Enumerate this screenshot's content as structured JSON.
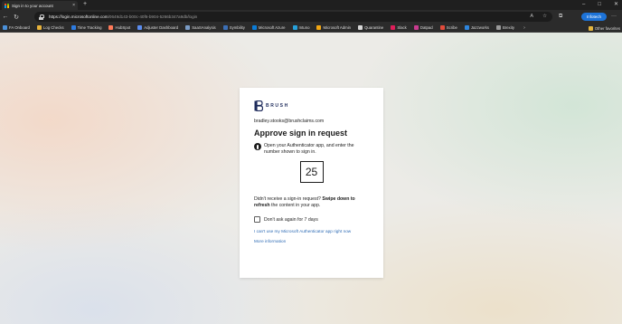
{
  "browser": {
    "tab_title": "Sign in to your account",
    "tab_close": "×",
    "new_tab": "+",
    "url_host": "https://login.microsoftonline.com",
    "url_path": "/0649d143-b00c-40f6-b904-5266b347a9db/login",
    "profile_label": "Infotech",
    "more": "···",
    "bookmarks": [
      {
        "label": "FA Onboard",
        "color": "#4a90d9"
      },
      {
        "label": "Log Checks",
        "color": "#e8b33b"
      },
      {
        "label": "Time Tracking",
        "color": "#2d7be0"
      },
      {
        "label": "HubSpot",
        "color": "#ff7a59"
      },
      {
        "label": "Adjuster Dashboard",
        "color": "#5b8def"
      },
      {
        "label": "SaaSAnalysis",
        "color": "#7a9cc6"
      },
      {
        "label": "Symbility",
        "color": "#3b6fb6"
      },
      {
        "label": "Microsoft Azure",
        "color": "#0a7bd6"
      },
      {
        "label": "Intuno",
        "color": "#26a0da"
      },
      {
        "label": "Microsoft Admin",
        "color": "#f3a712"
      },
      {
        "label": "Quarantine",
        "color": "#d8d8d8"
      },
      {
        "label": "Slack",
        "color": "#e01e5a"
      },
      {
        "label": "Datpad",
        "color": "#c93b8f"
      },
      {
        "label": "Scribe",
        "color": "#e24b3b"
      },
      {
        "label": "Jazzworks",
        "color": "#2e86de"
      },
      {
        "label": "Brexity",
        "color": "#9a9a9a"
      }
    ],
    "bookmarks_more": "›",
    "other_favorites": "Other favorites"
  },
  "card": {
    "logo_text": "BRUSH",
    "email": "bradley.stooks@brushclaims.com",
    "heading": "Approve sign in request",
    "instruction": "Open your Authenticator app, and enter the number shown to sign in.",
    "number": "25",
    "help_prefix": "Didn't receive a sign-in request?",
    "help_bold": "Swipe down to refresh",
    "help_suffix": "the content in your app.",
    "dont_ask_label": "Don't ask again for 7 days",
    "cant_use_link": "I can't use my Microsoft Authenticator app right now",
    "more_info_link": "More information"
  },
  "colors": {
    "link": "#2f6cb5",
    "profile_button": "#1d73d8",
    "logo": "#1f2c5c"
  }
}
